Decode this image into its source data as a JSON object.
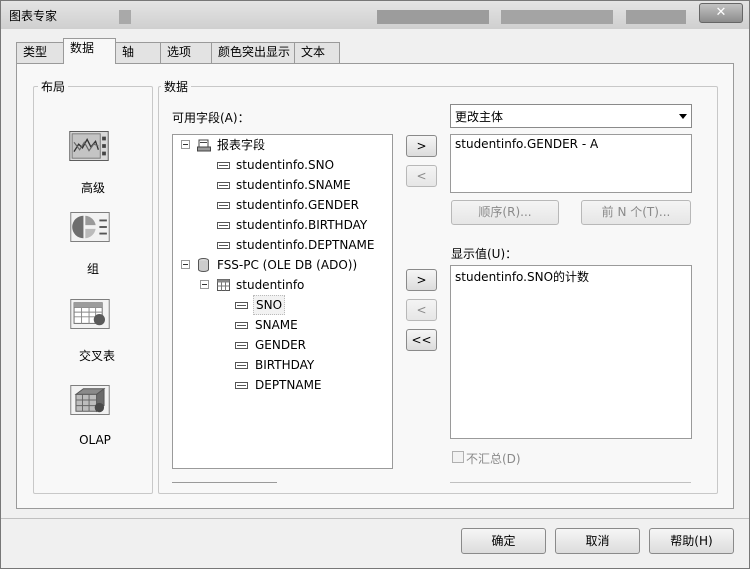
{
  "window": {
    "title": "图表专家",
    "close_glyph": "✕"
  },
  "tabs": [
    {
      "label": "类型"
    },
    {
      "label": "数据"
    },
    {
      "label": "轴"
    },
    {
      "label": "选项"
    },
    {
      "label": "颜色突出显示"
    },
    {
      "label": "文本"
    }
  ],
  "active_tab": "数据",
  "layout_group": {
    "title": "布局",
    "items": [
      {
        "label": "高级",
        "icon": "advanced-chart-icon",
        "selected": true
      },
      {
        "label": "组",
        "icon": "group-chart-icon"
      },
      {
        "label": "交叉表",
        "icon": "crosstab-chart-icon"
      },
      {
        "label": "OLAP",
        "icon": "olap-chart-icon"
      }
    ]
  },
  "data_group": {
    "title": "数据",
    "available_fields_label": "可用字段(A)：",
    "tree": {
      "report_fields": {
        "label": "报表字段",
        "items": [
          "studentinfo.SNO",
          "studentinfo.SNAME",
          "studentinfo.GENDER",
          "studentinfo.BIRTHDAY",
          "studentinfo.DEPTNAME"
        ]
      },
      "connection": {
        "label": "FSS-PC (OLE DB (ADO))",
        "table": {
          "label": "studentinfo",
          "fields": [
            "SNO",
            "SNAME",
            "GENDER",
            "BIRTHDAY",
            "DEPTNAME"
          ]
        }
      }
    },
    "on_change_button": ">",
    "on_change_remove_button": "<",
    "show_add_button": ">",
    "show_remove_button": "<",
    "show_remove_all_button": "<<",
    "on_change_dropdown": "更改主体",
    "on_change_list": [
      "studentinfo.GENDER - A"
    ],
    "order_button": "顺序(R)...",
    "topn_button": "前 N 个(T)...",
    "show_values_label": "显示值(U)：",
    "show_values_list": [
      "studentinfo.SNO的计数"
    ],
    "dont_summarize_label": "不汇总(D)"
  },
  "footer": {
    "ok_label": "确定",
    "cancel_label": "取消",
    "help_label": "帮助(H)"
  },
  "colors": {
    "window_bg": "#f0f0f0",
    "panel_bg": "#f8f8f8",
    "border": "#9a9a9a"
  }
}
